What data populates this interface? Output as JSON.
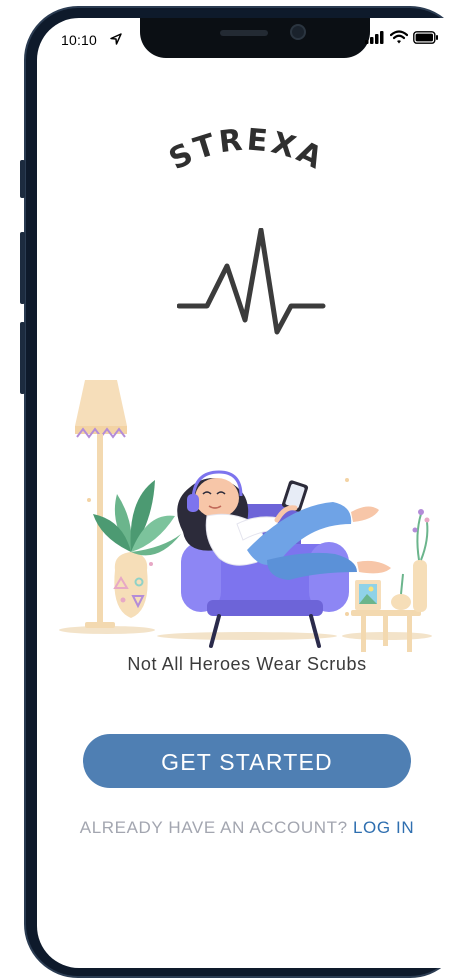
{
  "status_bar": {
    "time": "10:10",
    "icons": [
      "location-arrow-icon",
      "cellular-signal-icon",
      "wifi-icon",
      "battery-icon"
    ]
  },
  "brand": {
    "logo_text": "STREXA",
    "logo_color": "#2f2f2f"
  },
  "hero": {
    "pulse_icon": "heartbeat-pulse-icon",
    "illustration": "person-relaxing-in-armchair-illustration"
  },
  "tagline": "Not All Heroes Wear Scrubs",
  "cta": {
    "label": "GET STARTED",
    "color": "#4f7fb3"
  },
  "account": {
    "question": "ALREADY HAVE AN ACCOUNT?",
    "login_label": "LOG IN",
    "login_color": "#2f6fb0"
  }
}
